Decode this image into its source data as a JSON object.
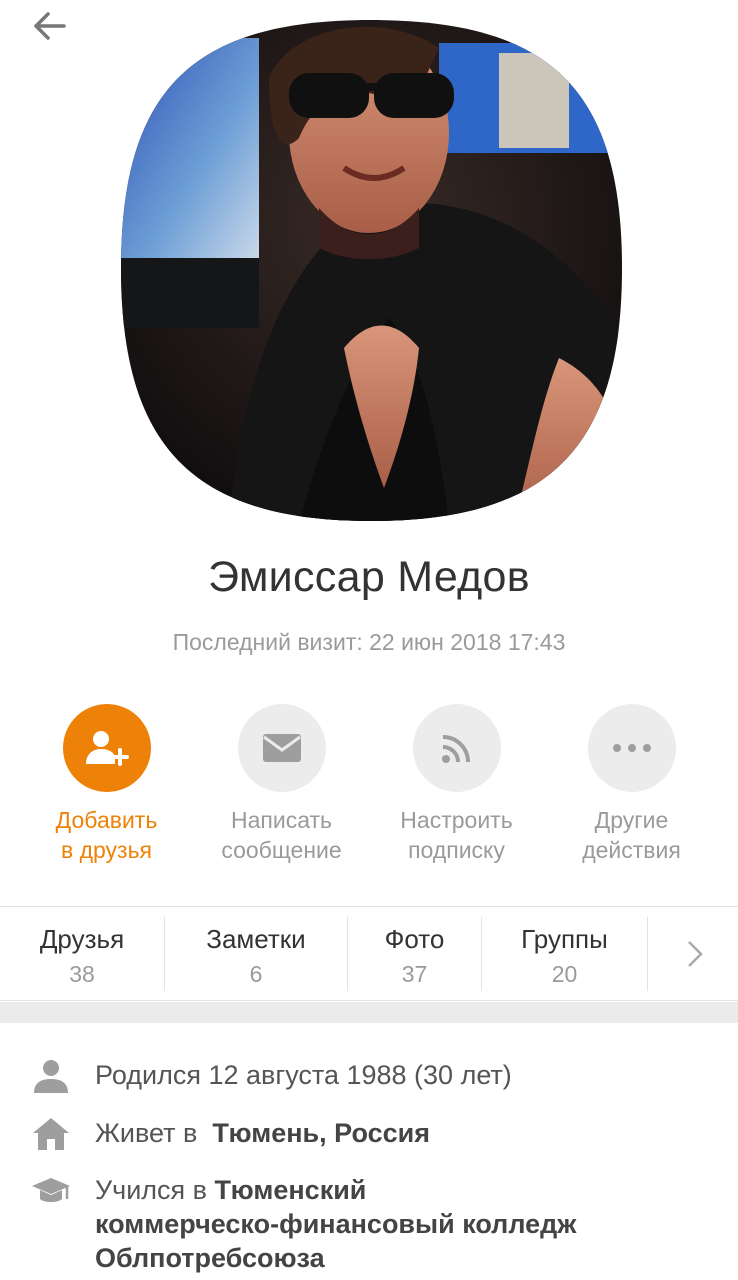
{
  "header": {
    "back_icon": "arrow-left-icon"
  },
  "profile": {
    "name": "Эмиссар Медов",
    "last_visit": "Последний визит: 22 июн 2018 17:43",
    "avatar": "profile-photo"
  },
  "actions": [
    {
      "label_line1": "Добавить",
      "label_line2": "в друзья",
      "icon": "add-friend-icon"
    },
    {
      "label_line1": "Написать",
      "label_line2": "сообщение",
      "icon": "envelope-icon"
    },
    {
      "label_line1": "Настроить",
      "label_line2": "подписку",
      "icon": "rss-icon"
    },
    {
      "label_line1": "Другие",
      "label_line2": "действия",
      "icon": "more-dots-icon"
    }
  ],
  "stats": [
    {
      "label": "Друзья",
      "count": "38"
    },
    {
      "label": "Заметки",
      "count": "6"
    },
    {
      "label": "Фото",
      "count": "37"
    },
    {
      "label": "Группы",
      "count": "20"
    }
  ],
  "info": {
    "born": "Родился 12 августа 1988 (30 лет)",
    "lives_prefix": "Живет в",
    "lives_city": "Тюмень, Россия",
    "studied_prefix": "Учился в",
    "studied_school_l1": "Тюменский",
    "studied_school_l2": "коммерческо-финансовый колледж",
    "studied_school_l3": "Облпотребсоюза"
  },
  "colors": {
    "accent": "#ee8208",
    "muted": "#9a9a9a",
    "circle_bg": "#ececec"
  }
}
